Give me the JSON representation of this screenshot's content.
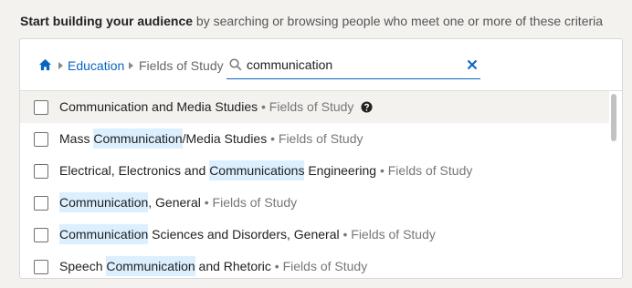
{
  "intro": {
    "bold": "Start building your audience",
    "rest": " by searching or browsing people who meet one or more of these criteria"
  },
  "breadcrumb": {
    "education": "Education",
    "current": "Fields of Study"
  },
  "search": {
    "value": "communication"
  },
  "category_suffix": " • Fields of Study",
  "results": [
    {
      "pre": "",
      "hl": "",
      "post": "Communication and Media Studies"
    },
    {
      "pre": "Mass ",
      "hl": "Communication",
      "post": "/Media Studies"
    },
    {
      "pre": "Electrical, Electronics and ",
      "hl": "Communications",
      "post": " Engineering"
    },
    {
      "pre": "",
      "hl": "Communication",
      "post": ", General"
    },
    {
      "pre": "",
      "hl": "Communication",
      "post": " Sciences and Disorders, General"
    },
    {
      "pre": "Speech ",
      "hl": "Communication",
      "post": " and Rhetoric"
    }
  ],
  "colors": {
    "link": "#0a66c2",
    "highlight": "#dcefff"
  }
}
